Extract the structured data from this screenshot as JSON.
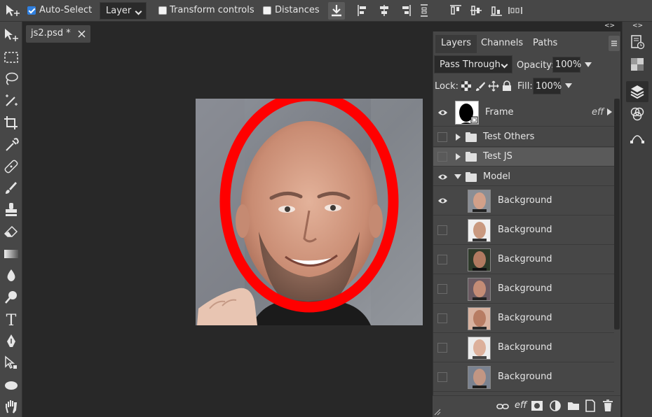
{
  "toolbar": {
    "auto_select_label": "Auto-Select",
    "auto_select_checked": true,
    "layer_select_value": "Layer",
    "transform_label": "Transform controls",
    "transform_checked": false,
    "distances_label": "Distances",
    "distances_checked": false
  },
  "document_tab": {
    "title": "js2.psd *"
  },
  "panel": {
    "tabs": [
      "Layers",
      "Channels",
      "Paths"
    ],
    "active_tab": "Layers",
    "blend_mode": "Pass Through",
    "opacity_label": "Opacity:",
    "opacity_value": "100%",
    "lock_label": "Lock:",
    "fill_label": "Fill:",
    "fill_value": "100%",
    "collapse_label": "<>",
    "layers": [
      {
        "name": "Frame",
        "visible": true,
        "fx": "eff"
      },
      {
        "name": "Test Others",
        "visible": false,
        "type": "group"
      },
      {
        "name": "Test JS",
        "visible": false,
        "type": "group",
        "selected": true
      },
      {
        "name": "Model",
        "visible": true,
        "type": "group",
        "expanded": true
      },
      {
        "name": "Background",
        "visible": true
      },
      {
        "name": "Background",
        "visible": false
      },
      {
        "name": "Background",
        "visible": false
      },
      {
        "name": "Background",
        "visible": false
      },
      {
        "name": "Background",
        "visible": false
      },
      {
        "name": "Background",
        "visible": false
      },
      {
        "name": "Background",
        "visible": false
      }
    ],
    "bottom_fx_label": "eff"
  },
  "colors": {
    "accent": "#2f7fdf",
    "frame_red": "#ff0000"
  }
}
